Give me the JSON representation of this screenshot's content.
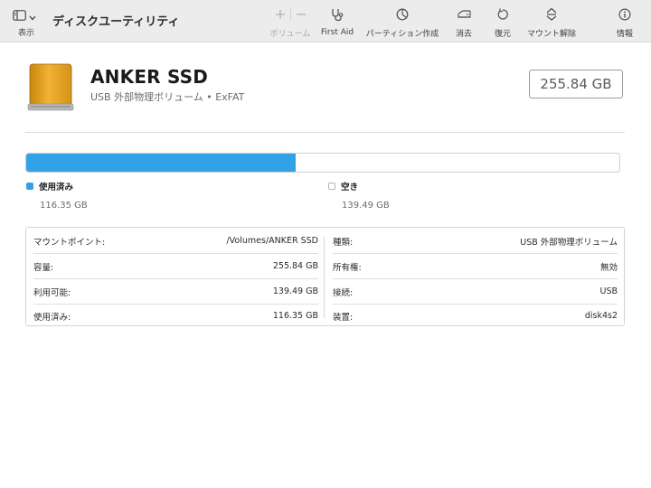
{
  "toolbar": {
    "sidebar_label": "表示",
    "app_title": "ディスクユーティリティ",
    "volume_label": "ボリューム",
    "firstaid_label": "First Aid",
    "partition_label": "パーティション作成",
    "erase_label": "消去",
    "restore_label": "復元",
    "unmount_label": "マウント解除",
    "info_label": "情報"
  },
  "drive": {
    "name": "ANKER SSD",
    "subtitle": "USB 外部物理ボリューム • ExFAT",
    "capacity_badge": "255.84 GB",
    "icon": "external-drive-icon"
  },
  "usage": {
    "used_fraction": 0.4546,
    "used_label": "使用済み",
    "used_value": "116.35 GB",
    "free_label": "空き",
    "free_value": "139.49 GB",
    "used_color": "#32a2e6",
    "free_color": "#ffffff"
  },
  "info": {
    "left": [
      {
        "key": "マウントポイント:",
        "value": "/Volumes/ANKER SSD"
      },
      {
        "key": "容量:",
        "value": "255.84 GB"
      },
      {
        "key": "利用可能:",
        "value": "139.49 GB"
      },
      {
        "key": "使用済み:",
        "value": "116.35 GB"
      }
    ],
    "right": [
      {
        "key": "種類:",
        "value": "USB 外部物理ボリューム"
      },
      {
        "key": "所有権:",
        "value": "無効"
      },
      {
        "key": "接続:",
        "value": "USB"
      },
      {
        "key": "装置:",
        "value": "disk4s2"
      }
    ]
  }
}
